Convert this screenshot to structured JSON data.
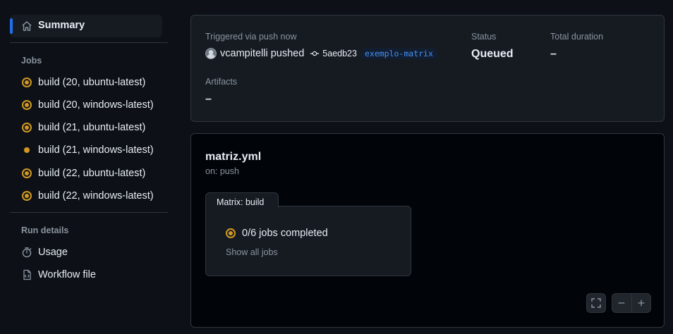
{
  "sidebar": {
    "summary_label": "Summary",
    "jobs_title": "Jobs",
    "jobs": [
      {
        "label": "build (20, ubuntu-latest)",
        "status": "queued"
      },
      {
        "label": "build (20, windows-latest)",
        "status": "queued"
      },
      {
        "label": "build (21, ubuntu-latest)",
        "status": "queued"
      },
      {
        "label": "build (21, windows-latest)",
        "status": "pending"
      },
      {
        "label": "build (22, ubuntu-latest)",
        "status": "queued"
      },
      {
        "label": "build (22, windows-latest)",
        "status": "queued"
      }
    ],
    "run_details_title": "Run details",
    "usage_label": "Usage",
    "workflow_file_label": "Workflow file"
  },
  "summary": {
    "trigger": "Triggered via push now",
    "actor": "vcampitelli pushed",
    "commit_sha": "5aedb23",
    "branch": "exemplo-matrix",
    "status_label": "Status",
    "status_value": "Queued",
    "duration_label": "Total duration",
    "duration_value": "–",
    "artifacts_label": "Artifacts",
    "artifacts_value": "–"
  },
  "workflow": {
    "file": "matriz.yml",
    "on": "on: push",
    "matrix_label": "Matrix: build",
    "jobs_completed": "0/6 jobs completed",
    "show_all": "Show all jobs"
  },
  "colors": {
    "accent": "#1f6feb",
    "queued": "#d29922",
    "background": "#0d1117",
    "branch": "#4493f8"
  }
}
